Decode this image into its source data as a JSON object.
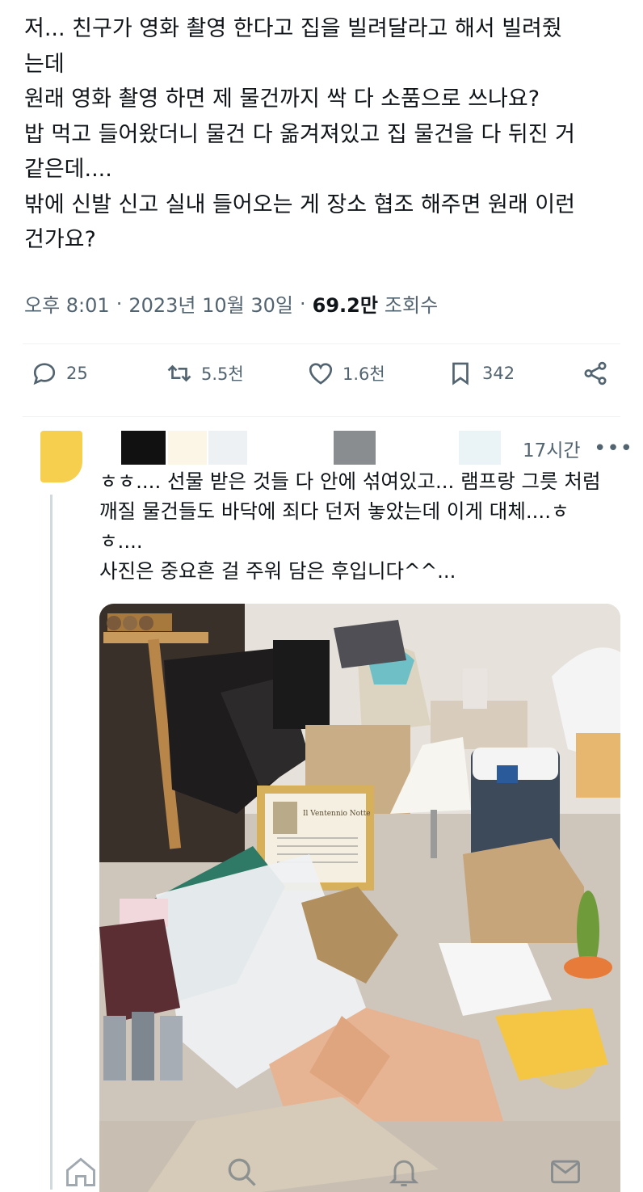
{
  "post": {
    "lines": [
      "저... 친구가 영화 촬영 한다고 집을 빌려달라고 해서 빌려줬",
      "는데",
      "원래 영화 촬영 하면 제 물건까지 싹 다 소품으로 쓰나요?",
      "밥 먹고 들어왔더니 물건 다 옮겨져있고 집 물건을 다 뒤진 거",
      "같은데....",
      "밖에 신발 신고 실내 들어오는 게 장소 협조 해주면 원래 이런",
      "건가요?"
    ],
    "time": "오후 8:01",
    "sep1": "·",
    "date": "2023년 10월 30일",
    "sep2": "·",
    "views_count": "69.2만",
    "views_label": "조회수"
  },
  "actions": {
    "reply_count": "25",
    "retweet_count": "5.5천",
    "like_count": "1.6천",
    "bookmark_count": "342"
  },
  "reply": {
    "time": "17시간",
    "more": "•••",
    "lines": [
      "ㅎㅎ.... 선물 받은 것들 다 안에 섞여있고... 램프랑 그릇 처럼",
      "깨질 물건들도 바닥에 죄다 던저 놓았는데 이게 대체....ㅎ",
      "ㅎ....",
      "사진은 중요흔 걸 주워 담은 후입니다^^..."
    ]
  },
  "photo_frame_text": "Il Ventennio Notte",
  "colors": {
    "text": "#0f1419",
    "secondary": "#536471",
    "border": "#eff3f4",
    "avatar": "#f6cf4f"
  },
  "icons": [
    "reply-icon",
    "retweet-icon",
    "like-icon",
    "bookmark-icon",
    "share-icon",
    "home-icon",
    "search-icon",
    "notifications-icon",
    "messages-icon"
  ]
}
